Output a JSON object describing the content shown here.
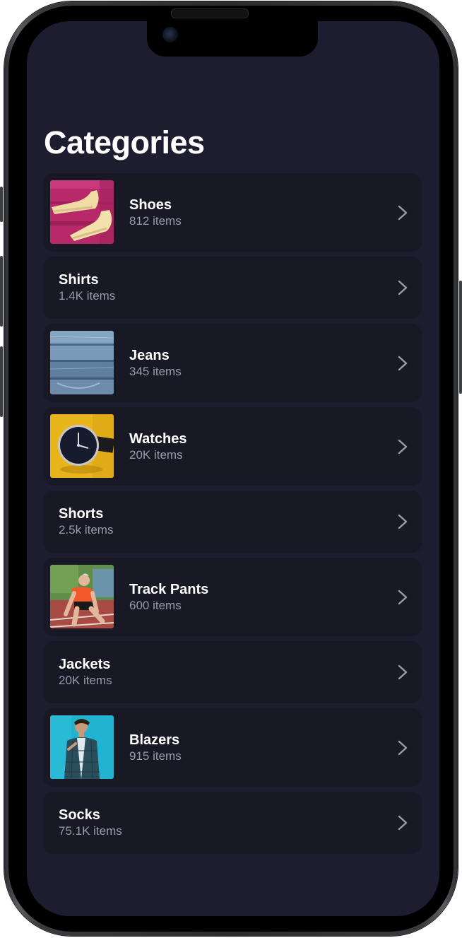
{
  "screen": {
    "title": "Categories",
    "background": "#1e1d2f",
    "row_background": "#191825"
  },
  "categories": [
    {
      "name": "Shoes",
      "count": "812 items",
      "image": "shoes-image"
    },
    {
      "name": "Shirts",
      "count": "1.4K items"
    },
    {
      "name": "Jeans",
      "count": "345 items",
      "image": "jeans-image"
    },
    {
      "name": "Watches",
      "count": "20K items",
      "image": "watch-image"
    },
    {
      "name": "Shorts",
      "count": "2.5k items"
    },
    {
      "name": "Track Pants",
      "count": "600 items",
      "image": "runner-image"
    },
    {
      "name": "Jackets",
      "count": "20K items"
    },
    {
      "name": "Blazers",
      "count": "915 items",
      "image": "blazer-image"
    },
    {
      "name": "Socks",
      "count": "75.1K items"
    }
  ],
  "icons": {
    "row_action": "chevron-right-icon"
  }
}
